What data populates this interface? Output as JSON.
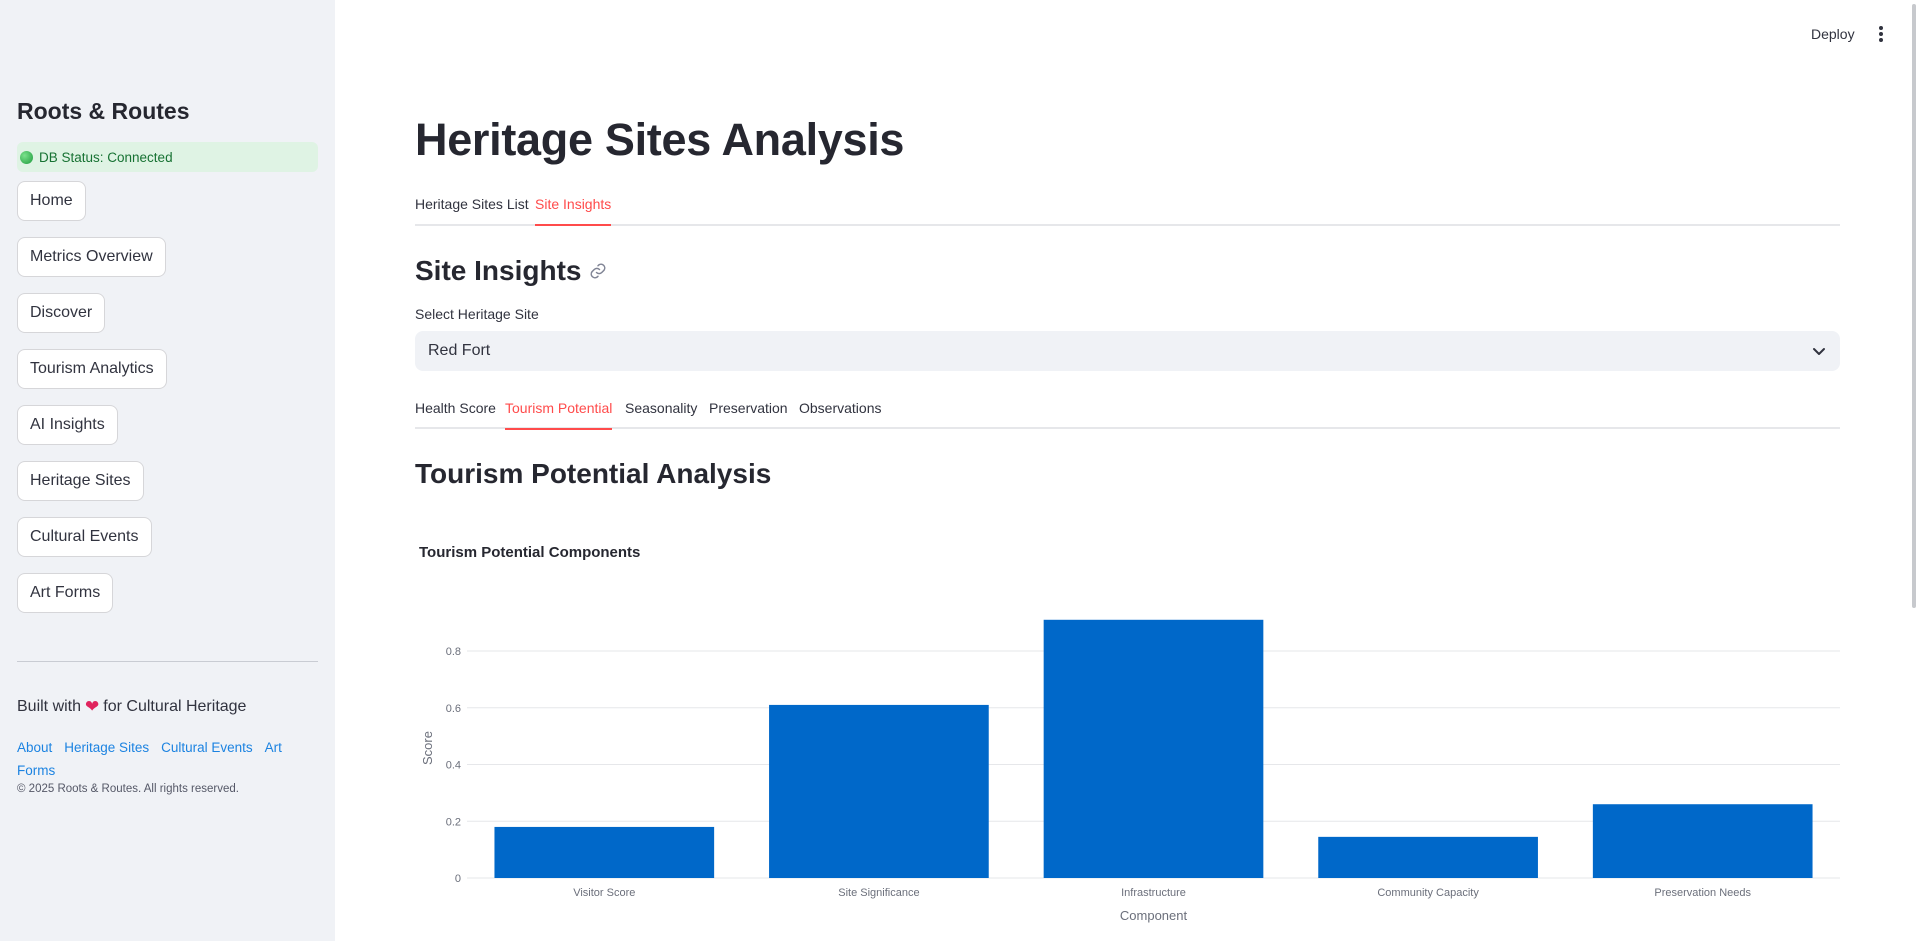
{
  "sidebar": {
    "brand": "Roots & Routes",
    "db_status": "DB Status: Connected",
    "nav": [
      "Home",
      "Metrics Overview",
      "Discover",
      "Tourism Analytics",
      "AI Insights",
      "Heritage Sites",
      "Cultural Events",
      "Art Forms"
    ],
    "built_prefix": "Built with",
    "built_suffix": "for Cultural Heritage",
    "links": [
      "About",
      "Heritage Sites",
      "Cultural Events",
      "Art Forms"
    ],
    "copyright": "© 2025 Roots & Routes. All rights reserved."
  },
  "header": {
    "deploy": "Deploy"
  },
  "main": {
    "title": "Heritage Sites Analysis",
    "tabs": [
      "Heritage Sites List",
      "Site Insights"
    ],
    "active_tab": "Site Insights",
    "section_title": "Site Insights",
    "select_label": "Select Heritage Site",
    "select_value": "Red Fort",
    "subtabs": [
      "Health Score",
      "Tourism Potential",
      "Seasonality",
      "Preservation",
      "Observations"
    ],
    "active_subtab": "Tourism Potential",
    "subsection_title": "Tourism Potential Analysis"
  },
  "colors": {
    "accent": "#ff4b4b",
    "bar": "#0068c9",
    "link": "#1c83e1"
  },
  "chart_data": {
    "type": "bar",
    "title": "Tourism Potential Components",
    "xlabel": "Component",
    "ylabel": "Score",
    "categories": [
      "Visitor Score",
      "Site Significance",
      "Infrastructure",
      "Community Capacity",
      "Preservation Needs"
    ],
    "values": [
      0.18,
      0.61,
      0.91,
      0.145,
      0.26
    ],
    "yticks": [
      "0",
      "0.2",
      "0.4",
      "0.6",
      "0.8"
    ],
    "ylim": [
      0,
      1.0
    ],
    "grid": true
  }
}
